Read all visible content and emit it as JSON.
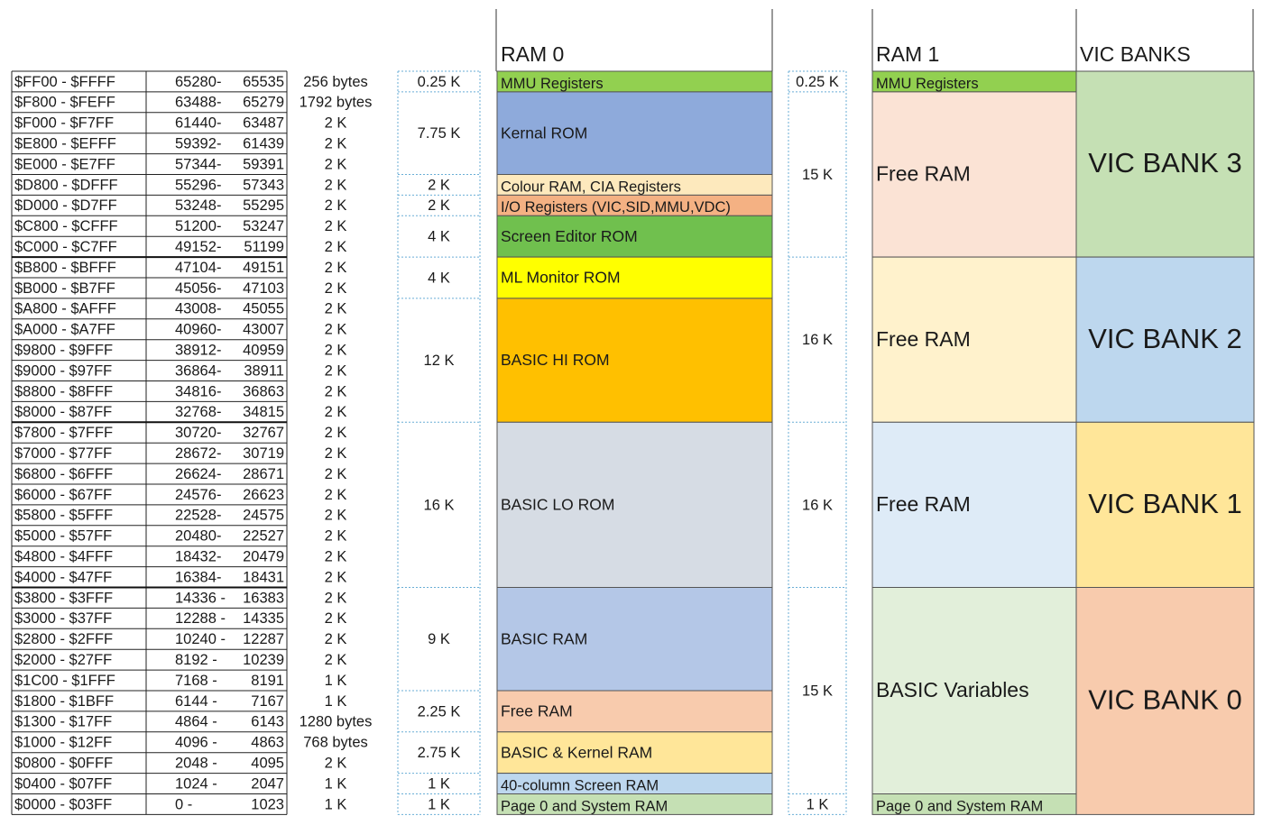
{
  "headers": {
    "ram0": "RAM 0",
    "ram1": "RAM 1",
    "vic": "VIC BANKS"
  },
  "rows": [
    {
      "hex": "$FF00  - $FFFF",
      "dec_from": "65280",
      "dec_to": "65535",
      "size": "256 bytes"
    },
    {
      "hex": "$F800  - $FEFF",
      "dec_from": "63488",
      "dec_to": "65279",
      "size": "1792 bytes"
    },
    {
      "hex": "$F000  - $F7FF",
      "dec_from": "61440",
      "dec_to": "63487",
      "size": "2 K"
    },
    {
      "hex": "$E800  - $EFFF",
      "dec_from": "59392",
      "dec_to": "61439",
      "size": "2 K"
    },
    {
      "hex": "$E000  - $E7FF",
      "dec_from": "57344",
      "dec_to": "59391",
      "size": "2 K"
    },
    {
      "hex": "$D800  - $DFFF",
      "dec_from": "55296",
      "dec_to": "57343",
      "size": "2 K"
    },
    {
      "hex": "$D000  - $D7FF",
      "dec_from": "53248",
      "dec_to": "55295",
      "size": "2 K"
    },
    {
      "hex": "$C800  - $CFFF",
      "dec_from": "51200",
      "dec_to": "53247",
      "size": "2 K"
    },
    {
      "hex": "$C000  - $C7FF",
      "dec_from": "49152",
      "dec_to": "51199",
      "size": "2 K"
    },
    {
      "hex": "$B800  - $BFFF",
      "dec_from": "47104",
      "dec_to": "49151",
      "size": "2 K"
    },
    {
      "hex": "$B000  - $B7FF",
      "dec_from": "45056",
      "dec_to": "47103",
      "size": "2 K"
    },
    {
      "hex": "$A800  - $AFFF",
      "dec_from": "43008",
      "dec_to": "45055",
      "size": "2 K"
    },
    {
      "hex": "$A000  - $A7FF",
      "dec_from": "40960",
      "dec_to": "43007",
      "size": "2 K"
    },
    {
      "hex": "$9800  - $9FFF",
      "dec_from": "38912",
      "dec_to": "40959",
      "size": "2 K"
    },
    {
      "hex": "$9000  - $97FF",
      "dec_from": "36864",
      "dec_to": "38911",
      "size": "2 K"
    },
    {
      "hex": "$8800  - $8FFF",
      "dec_from": "34816",
      "dec_to": "36863",
      "size": "2 K"
    },
    {
      "hex": "$8000  - $87FF",
      "dec_from": "32768",
      "dec_to": "34815",
      "size": "2 K"
    },
    {
      "hex": "$7800  - $7FFF",
      "dec_from": "30720",
      "dec_to": "32767",
      "size": "2 K"
    },
    {
      "hex": "$7000  - $77FF",
      "dec_from": "28672",
      "dec_to": "30719",
      "size": "2 K"
    },
    {
      "hex": "$6800  - $6FFF",
      "dec_from": "26624",
      "dec_to": "28671",
      "size": "2 K"
    },
    {
      "hex": "$6000  - $67FF",
      "dec_from": "24576",
      "dec_to": "26623",
      "size": "2 K"
    },
    {
      "hex": "$5800  - $5FFF",
      "dec_from": "22528",
      "dec_to": "24575",
      "size": "2 K"
    },
    {
      "hex": "$5000  - $57FF",
      "dec_from": "20480",
      "dec_to": "22527",
      "size": "2 K"
    },
    {
      "hex": "$4800  - $4FFF",
      "dec_from": "18432",
      "dec_to": "20479",
      "size": "2 K"
    },
    {
      "hex": "$4000  - $47FF",
      "dec_from": "16384",
      "dec_to": "18431",
      "size": "2 K"
    },
    {
      "hex": "$3800  - $3FFF",
      "dec_from": "14336 -",
      "dec_to": "16383",
      "size": "2 K"
    },
    {
      "hex": "$3000  - $37FF",
      "dec_from": "12288 -",
      "dec_to": "14335",
      "size": "2 K"
    },
    {
      "hex": "$2800  - $2FFF",
      "dec_from": "10240 -",
      "dec_to": "12287",
      "size": "2 K"
    },
    {
      "hex": "$2000  - $27FF",
      "dec_from": "8192 -",
      "dec_to": "10239",
      "size": "2 K"
    },
    {
      "hex": "$1C00  - $1FFF",
      "dec_from": "7168 -",
      "dec_to": "8191",
      "size": "1 K"
    },
    {
      "hex": "$1800  - $1BFF",
      "dec_from": "6144 -",
      "dec_to": "7167",
      "size": "1 K"
    },
    {
      "hex": "$1300  - $17FF",
      "dec_from": "4864 -",
      "dec_to": "6143",
      "size": "1280 bytes"
    },
    {
      "hex": "$1000  - $12FF",
      "dec_from": "4096 -",
      "dec_to": "4863",
      "size": "768 bytes"
    },
    {
      "hex": "$0800  - $0FFF",
      "dec_from": "2048 -",
      "dec_to": "4095",
      "size": "2 K"
    },
    {
      "hex": "$0400  - $07FF",
      "dec_from": "1024 -",
      "dec_to": "2047",
      "size": "1 K"
    },
    {
      "hex": "$0000  - $03FF",
      "dec_from": "0 -",
      "dec_to": "1023",
      "size": "1 K"
    }
  ],
  "ram0_size_labels": [
    {
      "text": "0.25 K",
      "rows": [
        0,
        0
      ]
    },
    {
      "text": "7.75 K",
      "rows": [
        1,
        4
      ]
    },
    {
      "text": "2 K",
      "rows": [
        5,
        5
      ]
    },
    {
      "text": "2 K",
      "rows": [
        6,
        6
      ]
    },
    {
      "text": "4 K",
      "rows": [
        7,
        8
      ]
    },
    {
      "text": "4 K",
      "rows": [
        9,
        10
      ]
    },
    {
      "text": "12 K",
      "rows": [
        11,
        16
      ]
    },
    {
      "text": "16 K",
      "rows": [
        17,
        24
      ]
    },
    {
      "text": "9 K",
      "rows": [
        25,
        29
      ]
    },
    {
      "text": "2.25 K",
      "rows": [
        30,
        31
      ]
    },
    {
      "text": "2.75 K",
      "rows": [
        32,
        33
      ]
    },
    {
      "text": "1 K",
      "rows": [
        34,
        34
      ]
    },
    {
      "text": "1 K",
      "rows": [
        35,
        35
      ]
    }
  ],
  "ram0_blocks": [
    {
      "label": "MMU Registers",
      "rows": [
        0,
        0
      ],
      "color": "#92d050"
    },
    {
      "label": "Kernal ROM",
      "rows": [
        1,
        4
      ],
      "color": "#8eaadb"
    },
    {
      "label": "Colour RAM, CIA Registers",
      "rows": [
        5,
        5
      ],
      "color": "#fde9bd"
    },
    {
      "label": "I/O Registers (VIC,SID,MMU,VDC)",
      "rows": [
        6,
        6
      ],
      "color": "#f4b183"
    },
    {
      "label": "Screen Editor ROM",
      "rows": [
        7,
        8
      ],
      "color": "#70c04e"
    },
    {
      "label": "ML Monitor ROM",
      "rows": [
        9,
        10
      ],
      "color": "#ffff00"
    },
    {
      "label": "BASIC HI ROM",
      "rows": [
        11,
        16
      ],
      "color": "#ffc000"
    },
    {
      "label": "BASIC LO ROM",
      "rows": [
        17,
        24
      ],
      "color": "#d6dce4"
    },
    {
      "label": "BASIC RAM",
      "rows": [
        25,
        29
      ],
      "color": "#b4c7e7"
    },
    {
      "label": "Free RAM",
      "rows": [
        30,
        31
      ],
      "color": "#f8cbad"
    },
    {
      "label": "BASIC & Kernel RAM",
      "rows": [
        32,
        33
      ],
      "color": "#ffe699"
    },
    {
      "label": "40-column Screen RAM",
      "rows": [
        34,
        34
      ],
      "color": "#bdd7ee"
    },
    {
      "label": "Page 0 and System RAM",
      "rows": [
        35,
        35
      ],
      "color": "#c5e0b4"
    }
  ],
  "ram1_size_labels": [
    {
      "text": "0.25 K",
      "rows": [
        0,
        0
      ]
    },
    {
      "text": "15 K",
      "rows": [
        1,
        8
      ]
    },
    {
      "text": "16 K",
      "rows": [
        9,
        16
      ]
    },
    {
      "text": "16 K",
      "rows": [
        17,
        24
      ]
    },
    {
      "text": "15 K",
      "rows": [
        25,
        34
      ]
    },
    {
      "text": "1 K",
      "rows": [
        35,
        35
      ]
    }
  ],
  "ram1_blocks": [
    {
      "label": "MMU Registers",
      "rows": [
        0,
        0
      ],
      "color": "#92d050"
    },
    {
      "label": "Free RAM",
      "rows": [
        1,
        8
      ],
      "color": "#fbe3d5"
    },
    {
      "label": "Free RAM",
      "rows": [
        9,
        16
      ],
      "color": "#fff2cc"
    },
    {
      "label": "Free RAM",
      "rows": [
        17,
        24
      ],
      "color": "#deebf7"
    },
    {
      "label": "BASIC Variables",
      "rows": [
        25,
        34
      ],
      "color": "#e2efda"
    },
    {
      "label": "Page 0 and System RAM",
      "rows": [
        35,
        35
      ],
      "color": "#c5e0b4"
    }
  ],
  "vic_blocks": [
    {
      "label": "VIC BANK 3",
      "rows": [
        0,
        8
      ],
      "color": "#c5e0b4"
    },
    {
      "label": "VIC BANK 2",
      "rows": [
        9,
        16
      ],
      "color": "#bdd7ee"
    },
    {
      "label": "VIC BANK 1",
      "rows": [
        17,
        24
      ],
      "color": "#ffe699"
    },
    {
      "label": "VIC BANK 0",
      "rows": [
        25,
        35
      ],
      "color": "#f8cbad"
    }
  ]
}
